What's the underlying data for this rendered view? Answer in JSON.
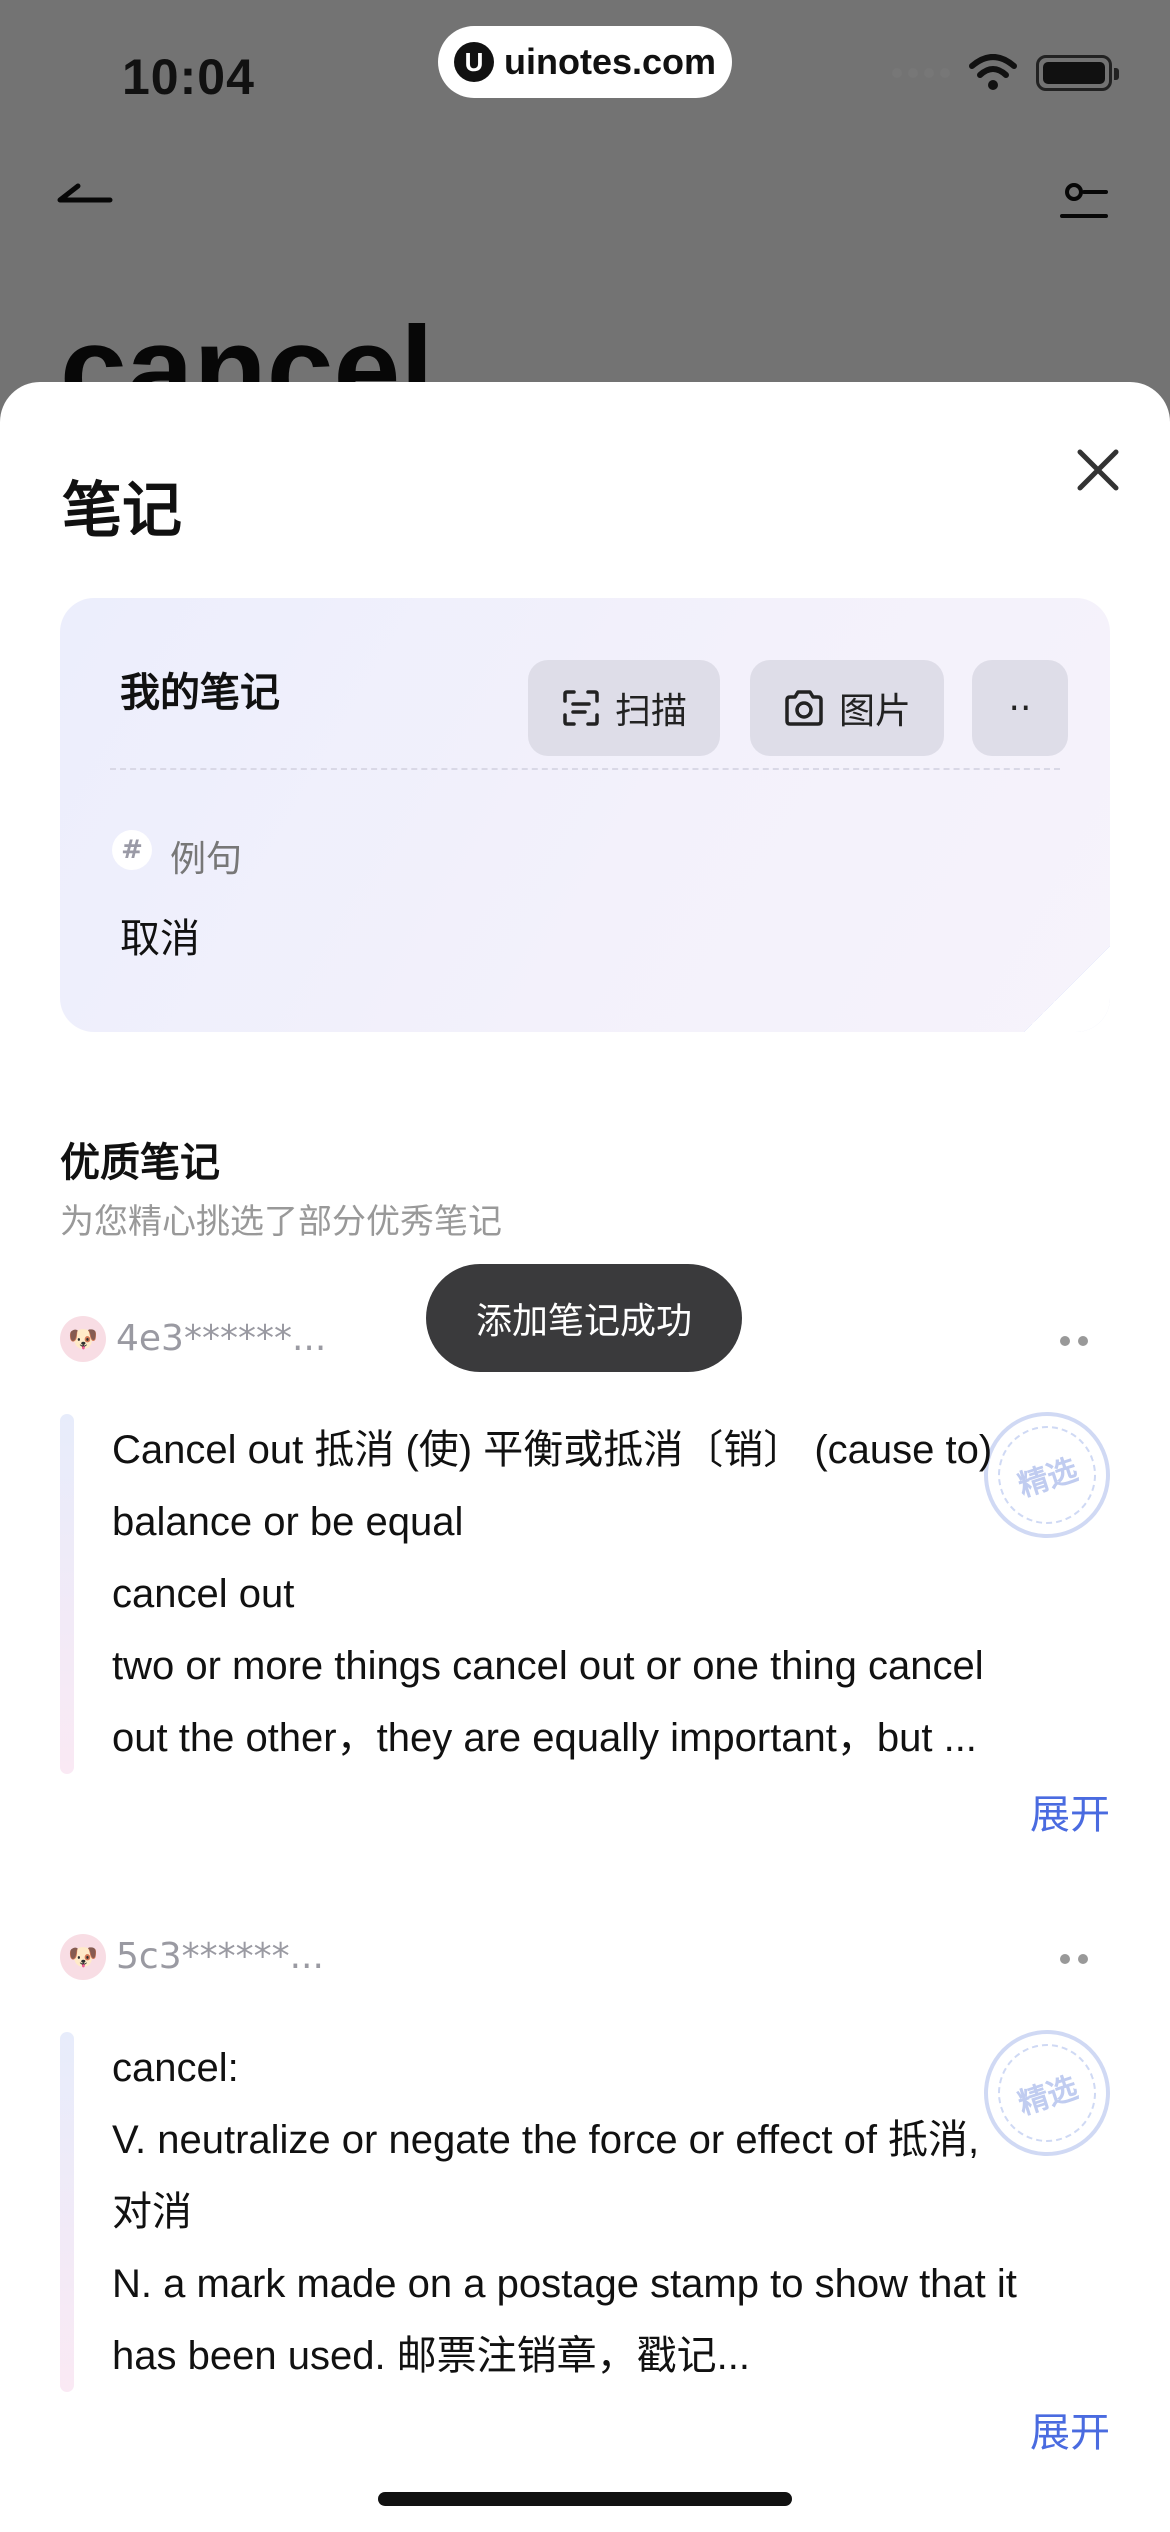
{
  "status_bar": {
    "time": "10:04",
    "pill_logo": "U",
    "pill_text": "uinotes.com"
  },
  "background_page": {
    "word": "cancel"
  },
  "sheet": {
    "title": "笔记"
  },
  "my_note": {
    "title": "我的笔记",
    "scan_label": "扫描",
    "image_label": "图片",
    "more_label": "··",
    "tag_symbol": "#",
    "tag_label": "例句",
    "content": "取消"
  },
  "quality": {
    "title": "优质笔记",
    "subtitle": "为您精心挑选了部分优秀笔记"
  },
  "toast": "添加笔记成功",
  "notes": [
    {
      "user": "4e3******...",
      "lines": [
        "Cancel out 抵消 (使) 平衡或抵消〔销〕 (cause to)",
        "balance or be equal",
        "cancel out",
        "two or more things cancel out or one thing cancel",
        "out the other，they are equally important，but ..."
      ],
      "badge": "精选",
      "expand": "展开"
    },
    {
      "user": "5c3******...",
      "lines": [
        "cancel:",
        "V. neutralize or negate the force or effect of 抵消,",
        "对消",
        "N. a mark made on a postage stamp to show that it",
        "has been used. 邮票注销章，戳记..."
      ],
      "badge": "精选",
      "expand": "展开"
    }
  ]
}
